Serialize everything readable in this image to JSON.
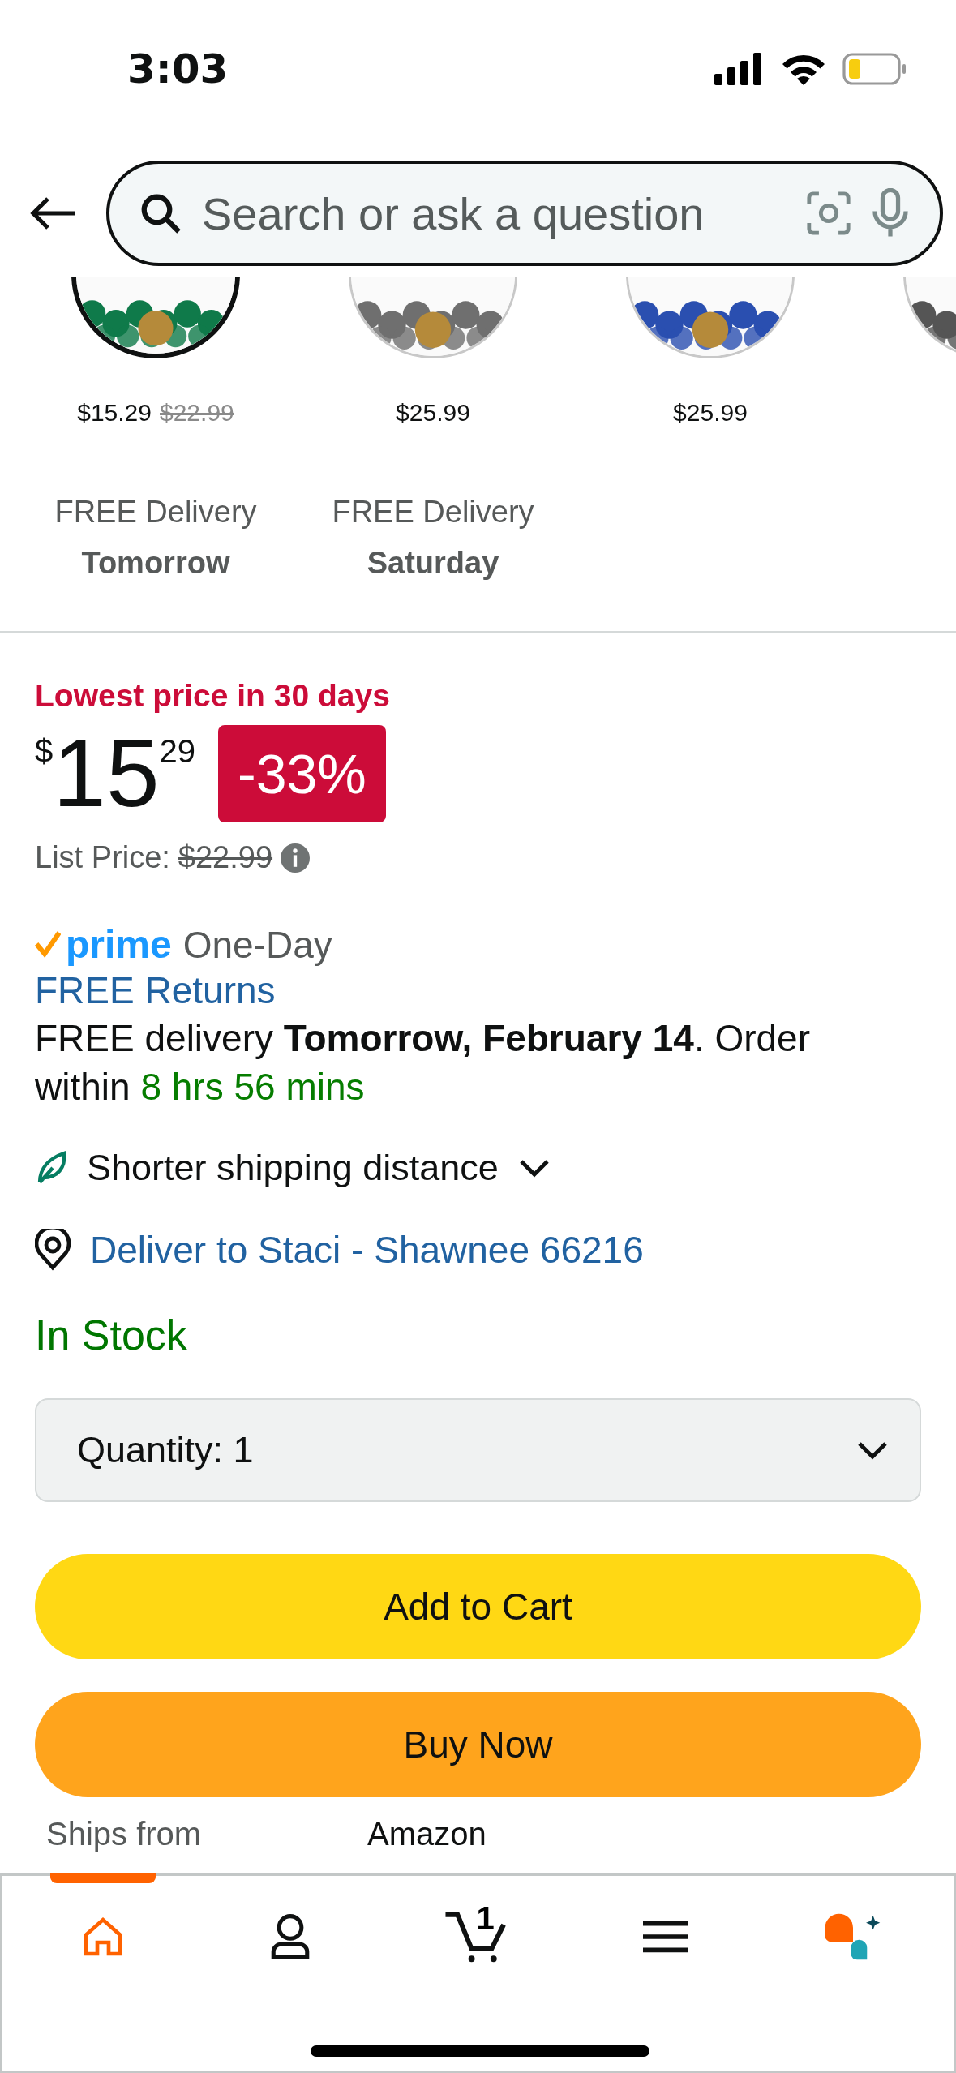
{
  "status_bar": {
    "time": "3:03"
  },
  "search": {
    "placeholder": "Search or ask a question"
  },
  "carousel": [
    {
      "price": "$15.29",
      "list_price": "$22.99",
      "delivery": "FREE Delivery",
      "day": "Tomorrow",
      "selected": true
    },
    {
      "price": "$25.99",
      "delivery": "FREE Delivery",
      "day": "Saturday",
      "selected": false
    },
    {
      "price": "$25.99",
      "selected": false
    },
    {
      "selected": false
    }
  ],
  "deal": {
    "badge": "Lowest price in 30 days",
    "currency": "$",
    "whole": "15",
    "fraction": "29",
    "discount": "-33%",
    "list_price_label": "List Price:",
    "list_price": "$22.99"
  },
  "delivery": {
    "prime": "prime",
    "prime_tier": "One-Day",
    "returns": "FREE Returns",
    "message": "FREE delivery **Tomorrow, February 14**. Order within",
    "countdown": "8 hrs 56 mins",
    "shipping_note": "Shorter shipping distance",
    "deliver_to": "Deliver to Staci - Shawnee 66216"
  },
  "stock": "In Stock",
  "quantity": {
    "label": "Quantity:",
    "value": "1"
  },
  "buttons": [
    {
      "label": "Add to Cart",
      "kind": "cart"
    },
    {
      "label": "Buy Now",
      "kind": "buy"
    }
  ],
  "details": [
    {
      "label": "Ships from",
      "value": "Amazon"
    }
  ],
  "nav": [
    {
      "kind": "home",
      "selected": true
    },
    {
      "kind": "account",
      "selected": false
    },
    {
      "kind": "cart",
      "badge": "1",
      "selected": false
    },
    {
      "kind": "menu",
      "selected": false
    },
    {
      "kind": "assistant",
      "selected": false
    }
  ]
}
